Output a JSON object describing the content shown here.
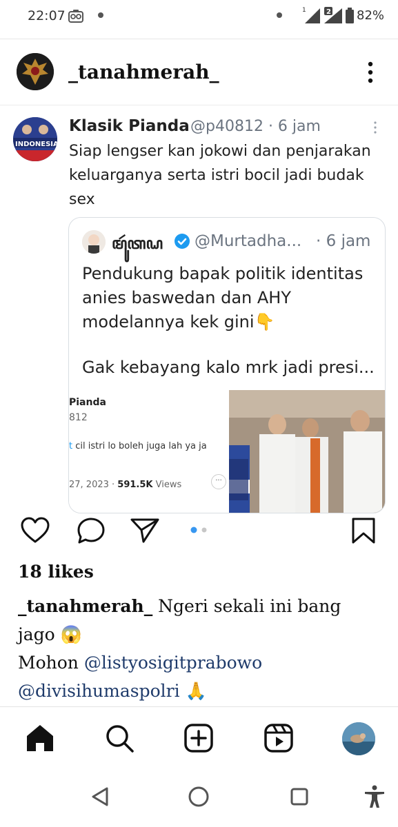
{
  "status_bar": {
    "time": "22:07",
    "sim1_label": "1",
    "sim2_label": "2",
    "battery": "82%",
    "icons": [
      "camera-icon",
      "notification-dot",
      "signal-icon",
      "battery-icon"
    ]
  },
  "post": {
    "username": "_tanahmerah_",
    "more_icon": "more-vertical-icon",
    "likes": "18 likes",
    "caption": {
      "user": "_tanahmerah_",
      "text1": " Ngeri sekali ini bang jago 😱",
      "text2_prefix": "Mohon ",
      "mention1": "@listyosigitprabowo",
      "mention2": "@divisihumaspolri",
      "text2_suffix": " 🙏"
    },
    "carousel": {
      "current": 1,
      "total": 2,
      "active_color": "#3897f0",
      "inactive_color": "#c7c7c7"
    }
  },
  "tweet": {
    "name": "Klasik Pianda",
    "handle": "@p40812 · 6 jam",
    "text": "Siap lengser kan jokowi dan penjarakan keluarganya serta istri bocil jadi budak sex",
    "quote": {
      "name": "ꦩꦸꦂꦠꦝ",
      "handle": "@Murtadha...",
      "time": "· 6 jam",
      "text1": "Pendukung bapak politik identitas anies baswedan dan AHY modelannya kek gini👇",
      "text2": "Gak kebayang kalo mrk jadi presi...",
      "embedded": {
        "name": "Pianda",
        "handle": "812",
        "text_blue": "t",
        "text": " cil istri lo boleh juga lah ya ja",
        "date": "27, 2023 · ",
        "views_count": "591.5K",
        "views_label": " Views",
        "dots": "···"
      }
    }
  },
  "bottom_nav": {
    "items": [
      "home-icon",
      "search-icon",
      "add-post-icon",
      "reels-icon",
      "profile-avatar"
    ]
  },
  "system_nav": {
    "items": [
      "back-icon",
      "home-circle-icon",
      "recents-icon",
      "accessibility-icon"
    ]
  }
}
